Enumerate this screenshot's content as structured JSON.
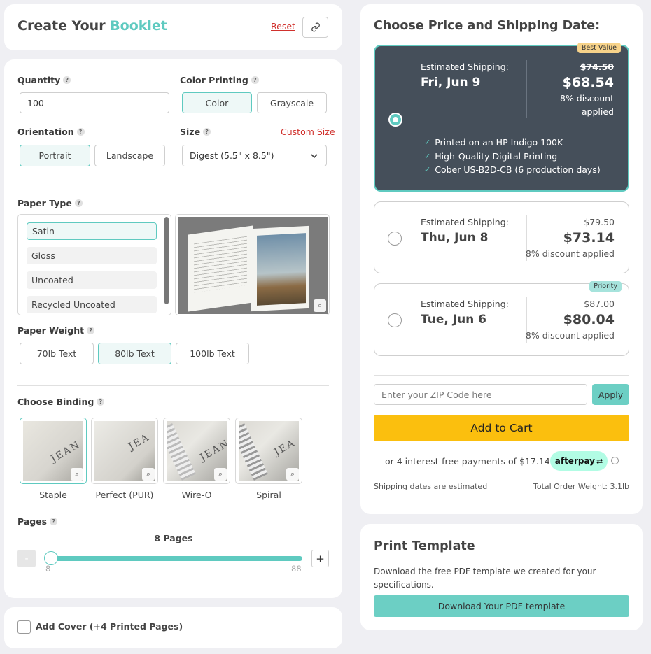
{
  "header": {
    "title_prefix": "Create Your",
    "title_accent": "Booklet",
    "reset_label": "Reset"
  },
  "quantity": {
    "label": "Quantity",
    "value": "100"
  },
  "color_printing": {
    "label": "Color Printing",
    "options": [
      "Color",
      "Grayscale"
    ],
    "selected": "Color"
  },
  "orientation": {
    "label": "Orientation",
    "options": [
      "Portrait",
      "Landscape"
    ],
    "selected": "Portrait"
  },
  "size": {
    "label": "Size",
    "custom_link": "Custom Size",
    "value": "Digest (5.5\" x 8.5\")"
  },
  "paper_type": {
    "label": "Paper Type",
    "items": [
      "Satin",
      "Gloss",
      "Uncoated",
      "Recycled Uncoated"
    ],
    "selected": "Satin"
  },
  "paper_weight": {
    "label": "Paper Weight",
    "options": [
      "70lb Text",
      "80lb Text",
      "100lb Text"
    ],
    "selected": "80lb Text"
  },
  "binding": {
    "label": "Choose Binding",
    "options": [
      {
        "label": "Staple",
        "cover_text": "JEAN"
      },
      {
        "label": "Perfect (PUR)",
        "cover_text": "JEA"
      },
      {
        "label": "Wire-O",
        "cover_text": "JEAN"
      },
      {
        "label": "Spiral",
        "cover_text": "JEA"
      }
    ],
    "selected": "Staple"
  },
  "pages": {
    "label": "Pages",
    "current_label": "8 Pages",
    "min": "8",
    "max": "88",
    "value": 8,
    "minus": "-",
    "plus": "+"
  },
  "cover": {
    "label": "Add Cover (+4 Printed Pages)",
    "checked": false
  },
  "shipping": {
    "title": "Choose Price and Shipping Date:",
    "options": [
      {
        "est_label": "Estimated Shipping:",
        "date": "Fri, Jun 9",
        "old_price": "$74.50",
        "price": "$68.54",
        "discount": "8% discount applied",
        "badge": "Best Value",
        "selected": true,
        "features": [
          "Printed on an HP Indigo 100K",
          "High-Quality Digital Printing",
          "Cober US-B2D-CB (6 production days)"
        ]
      },
      {
        "est_label": "Estimated Shipping:",
        "date": "Thu, Jun 8",
        "old_price": "$79.50",
        "price": "$73.14",
        "discount": "8% discount applied",
        "badge": "",
        "selected": false
      },
      {
        "est_label": "Estimated Shipping:",
        "date": "Tue, Jun 6",
        "old_price": "$87.00",
        "price": "$80.04",
        "discount": "8% discount applied",
        "badge": "Priority",
        "selected": false
      }
    ],
    "zip_placeholder": "Enter your ZIP Code here",
    "apply_label": "Apply",
    "add_to_cart": "Add to Cart",
    "installments_text": "or 4 interest-free payments of $17.14 with",
    "afterpay_label": "afterpay",
    "shipping_note": "Shipping dates are estimated",
    "order_weight": "Total Order Weight: 3.1lb"
  },
  "template": {
    "title": "Print Template",
    "description": "Download the free PDF template we created for your specifications.",
    "download_label": "Download Your PDF template"
  },
  "colors": {
    "accent": "#5fcac0",
    "dark_card": "#454f5a",
    "cart_button": "#fbbf0e",
    "link_red": "#d0312d"
  }
}
